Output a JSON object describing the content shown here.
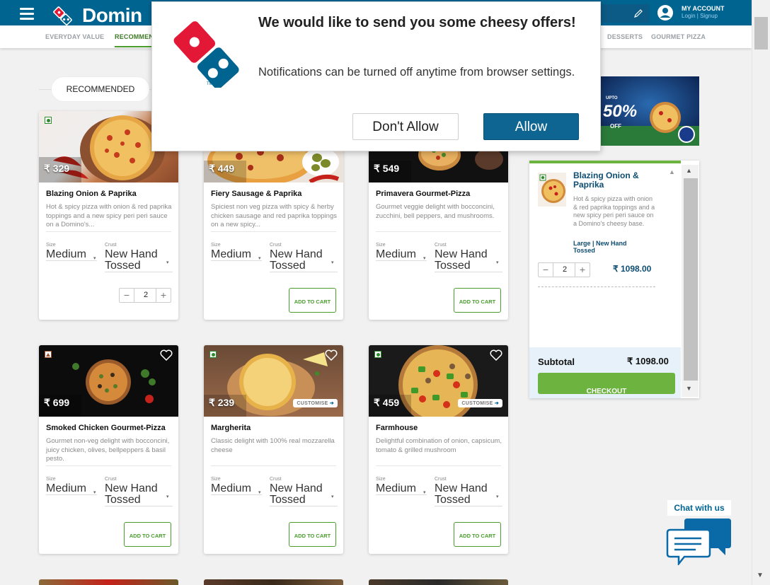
{
  "header": {
    "brand": "Domin",
    "account_title": "MY ACCOUNT",
    "account_sub": "Login | Signup"
  },
  "menu": {
    "items": [
      "EVERYDAY VALUE",
      "RECOMMEN",
      "DESSERTS",
      "GOURMET PIZZA"
    ]
  },
  "section": {
    "title": "RECOMMENDED"
  },
  "cards": [
    {
      "price": "₹ 329",
      "name": "Blazing Onion & Paprika",
      "desc": "Hot & spicy pizza with onion & red paprika toppings and a new spicy peri peri sauce on a Domino's...",
      "size_label": "Size",
      "size": "Medium",
      "crust_label": "Crust",
      "crust": "New Hand Tossed",
      "qty": "2",
      "veg": true
    },
    {
      "price": "₹ 449",
      "name": "Fiery Sausage & Paprika",
      "desc": "Spiciest non veg pizza with spicy & herby chicken sausage and red paprika toppings on a new spicy...",
      "size_label": "Size",
      "size": "Medium",
      "crust_label": "Crust",
      "crust": "New Hand Tossed",
      "cta": "ADD TO CART",
      "veg": false
    },
    {
      "price": "₹ 549",
      "name": "Primavera Gourmet-Pizza",
      "desc": "Gourmet veggie delight with bocconcini, zucchini, bell peppers, and mushrooms.",
      "size_label": "Size",
      "size": "Medium",
      "crust_label": "Crust",
      "crust": "New Hand Tossed",
      "cta": "ADD TO CART",
      "veg": true
    },
    {
      "price": "₹ 699",
      "name": "Smoked Chicken Gourmet-Pizza",
      "desc": "Gourmet non-veg delight with bocconcini, juicy chicken, olives, bellpeppers & basil pesto.",
      "size_label": "Size",
      "size": "Medium",
      "crust_label": "Crust",
      "crust": "New Hand Tossed",
      "cta": "ADD TO CART",
      "veg": false
    },
    {
      "price": "₹ 239",
      "name": "Margherita",
      "desc": "Classic delight with 100% real mozzarella cheese",
      "size_label": "Size",
      "size": "Medium",
      "crust_label": "Crust",
      "crust": "New Hand Tossed",
      "cta": "ADD TO CART",
      "customise": "CUSTOMISE",
      "veg": true
    },
    {
      "price": "₹ 459",
      "name": "Farmhouse",
      "desc": "Delightful combination of onion, capsicum, tomato & grilled mushroom",
      "size_label": "Size",
      "size": "Medium",
      "crust_label": "Crust",
      "crust": "New Hand Tossed",
      "cta": "ADD TO CART",
      "customise": "CUSTOMISE",
      "veg": true
    }
  ],
  "promo": {
    "line1": "UPTO",
    "line2": "50%",
    "line3": "OFF"
  },
  "cart": {
    "item_name": "Blazing Onion & Paprika",
    "item_desc": "Hot & spicy pizza with onion & red paprika toppings and a new spicy peri peri sauce on a Domino's cheesy base.",
    "size": "Large",
    "crust": "New Hand Tossed",
    "qty": "2",
    "price": "₹ 1098.00",
    "subtotal_label": "Subtotal",
    "subtotal": "₹ 1098.00",
    "checkout": "CHECKOUT"
  },
  "chat": {
    "label": "Chat with us"
  },
  "popup": {
    "title": "We would like to send you some cheesy offers!",
    "body": "Notifications can be turned off anytime from browser settings.",
    "deny": "Don't Allow",
    "allow": "Allow"
  },
  "colors": {
    "brand_blue": "#006491",
    "brand_red": "#e31837",
    "green": "#4a9c2d",
    "checkout_green": "#6db33f"
  }
}
